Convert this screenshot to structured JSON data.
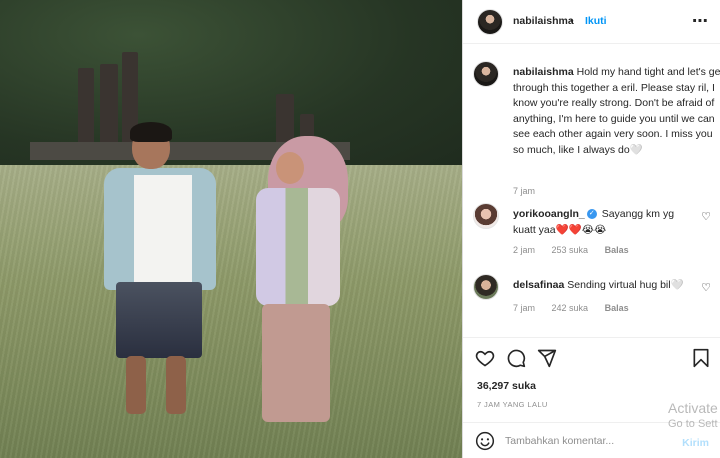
{
  "post": {
    "author": "nabilaishma",
    "dot": "•",
    "follow_label": "Ikuti",
    "more_icon": "more-horizontal-icon"
  },
  "caption": {
    "username": "nabilaishma",
    "text": "Hold my hand tight and let's get through this together a eril. Please stay ril, I know you're really strong. Don't be afraid of anything, I'm here to guide you until we can see each other again very soon. I miss you so much, like I always do🤍",
    "time": "7 jam"
  },
  "comments": [
    {
      "username": "yorikooangln_",
      "verified": true,
      "text": "Sayangg km yg kuatt yaa❤️❤️😭😭",
      "time": "2 jam",
      "likes": "253 suka",
      "reply": "Balas"
    },
    {
      "username": "delsafinaa",
      "verified": false,
      "text": "Sending virtual hug bil🤍",
      "time": "7 jam",
      "likes": "242 suka",
      "reply": "Balas"
    }
  ],
  "actions": {
    "like_icon": "heart-icon",
    "comment_icon": "comment-icon",
    "share_icon": "send-icon",
    "save_icon": "bookmark-icon"
  },
  "likes_count": "36,297 suka",
  "posted_time": "7 JAM YANG LALU",
  "add_comment": {
    "placeholder": "Tambahkan komentar...",
    "post_label": "Kirim"
  },
  "watermark": {
    "line1": "Activate",
    "line2": "Go to Sett"
  },
  "colors": {
    "link_blue": "#0095f6",
    "post_disabled": "#b2dffc",
    "muted": "#8e8e8e"
  }
}
